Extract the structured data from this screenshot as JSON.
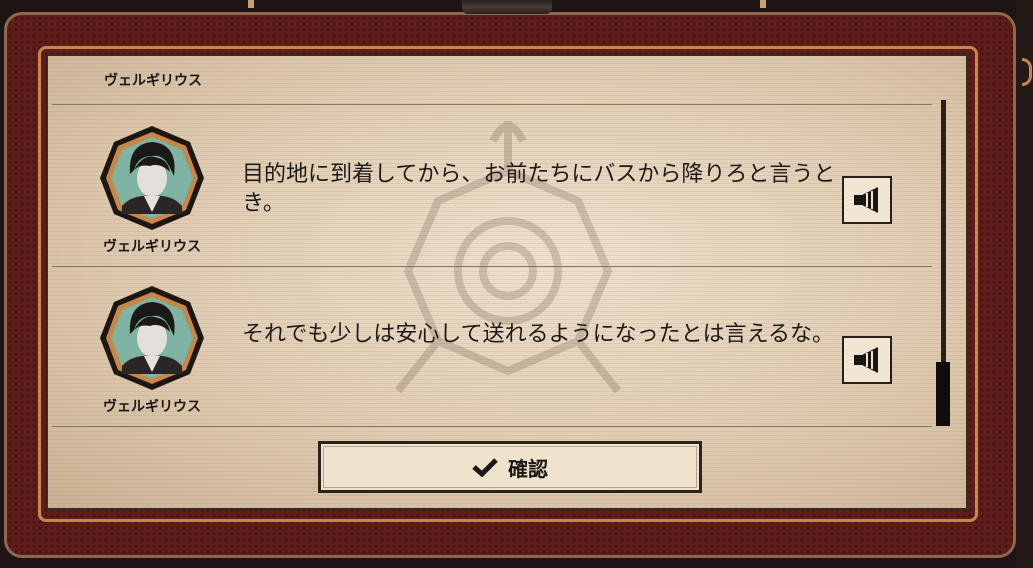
{
  "dialog": {
    "top_partial_name": "ヴェルギリウス",
    "entries": [
      {
        "speaker": "ヴェルギリウス",
        "text": "目的地に到着してから、お前たちにバスから降りろと言うとき。",
        "voice_icon": "speaker-icon"
      },
      {
        "speaker": "ヴェルギリウス",
        "text": "それでも少しは安心して送れるようになったとは言えるな。",
        "voice_icon": "speaker-icon"
      }
    ],
    "confirm_label": "確認",
    "confirm_icon": "checkmark-icon"
  },
  "colors": {
    "frame_red": "#5e1d1a",
    "frame_orange": "#c8874a",
    "panel_paper": "#e6d5bd",
    "avatar_teal": "#7fb3a3"
  }
}
